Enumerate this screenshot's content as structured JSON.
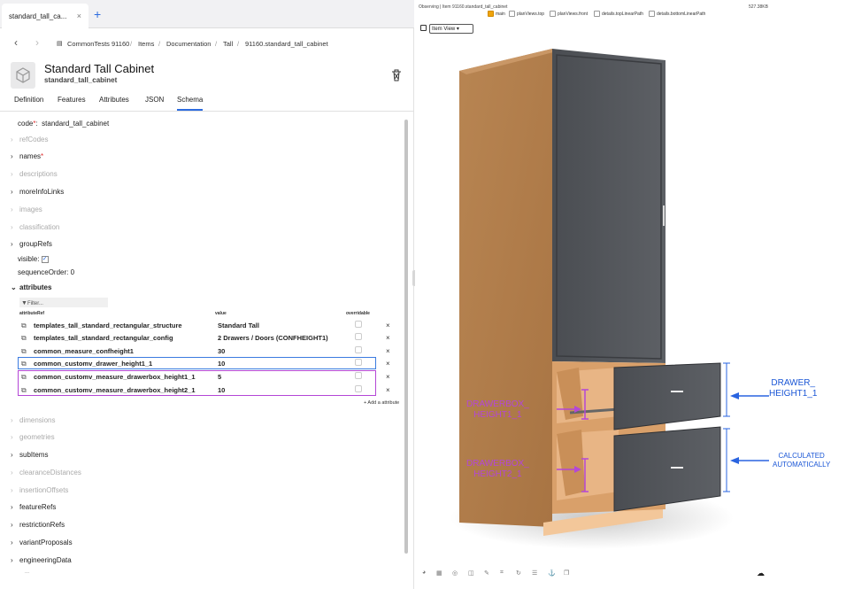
{
  "tab": {
    "label": "standard_tall_ca...",
    "close": "×",
    "add": "+"
  },
  "breadcrumb": [
    "CommonTests 91160",
    "Items",
    "Documentation",
    "Tall",
    "91160.standard_tall_cabinet"
  ],
  "item": {
    "title": "Standard Tall Cabinet",
    "subtitle": "standard_tall_cabinet"
  },
  "tabs": [
    "Definition",
    "Features",
    "Attributes",
    "JSON",
    "Schema"
  ],
  "fields": {
    "code_label": "code",
    "code_value": "standard_tall_cabinet",
    "refCodes": "refCodes",
    "names": "names",
    "descriptions": "descriptions",
    "moreInfoLinks": "moreInfoLinks",
    "images": "images",
    "classification": "classification",
    "groupRefs": "groupRefs",
    "visible": "visible:",
    "visible_check": "✓",
    "sequenceOrder": "sequenceOrder:",
    "sequenceOrder_value": "0",
    "attributes": "attributes",
    "filter": "Filter...",
    "col_ref": "attributeRef",
    "col_value": "value",
    "col_overridable": "overridable",
    "add_attribute": "+ Add a attribute",
    "dimensions": "dimensions",
    "geometries": "geometries",
    "subItems": "subItems",
    "clearanceDistances": "clearanceDistances",
    "insertionOffsets": "insertionOffsets",
    "featureRefs": "featureRefs",
    "restrictionRefs": "restrictionRefs",
    "variantProposals": "variantProposals",
    "engineeringData": "engineeringData",
    "more": "..."
  },
  "attributes": [
    {
      "ref": "templates_tall_standard_rectangular_structure",
      "value": "Standard Tall"
    },
    {
      "ref": "templates_tall_standard_rectangular_config",
      "value": "2 Drawers / Doors (CONFHEIGHT1)"
    },
    {
      "ref": "common_measure_confheight1",
      "value": "30"
    },
    {
      "ref": "common_customv_drawer_height1_1",
      "value": "10"
    },
    {
      "ref": "common_customv_measure_drawerbox_height1_1",
      "value": "5"
    },
    {
      "ref": "common_customv_measure_drawerbox_height2_1",
      "value": "10"
    }
  ],
  "viewer": {
    "title": "Observing | Item 91160.standard_tall_cabinet",
    "count": "527.38KB",
    "layers": [
      "main",
      "planViews.top",
      "planViews.front",
      "details.topLinearPath",
      "details.bottomLinearPath"
    ],
    "layers_checked": [
      true,
      false,
      false,
      false,
      false
    ],
    "view_mode": "Item View"
  },
  "annotations": {
    "drawer_label": [
      "DRAWER_",
      "HEIGHT1_1"
    ],
    "auto_label": [
      "CALCULATED",
      "AUTOMATICALLY"
    ],
    "box1_label": [
      "DRAWERBOX_",
      "HEIGHT1_1"
    ],
    "box2_label": [
      "DRAWERBOX_",
      "HEIGHT2_1"
    ]
  },
  "colors": {
    "accent": "#2d6cdf",
    "purple": "#b447d6",
    "annot_blue": "#1a56d6",
    "annot_purple": "#b447d6",
    "check_orange": "#f0a40b"
  },
  "icons": [
    "cube-icon",
    "trash-icon",
    "link-icon",
    "close-icon",
    "filter-icon",
    "chevron-right-icon",
    "chevron-down-icon",
    "cloud-icon"
  ]
}
